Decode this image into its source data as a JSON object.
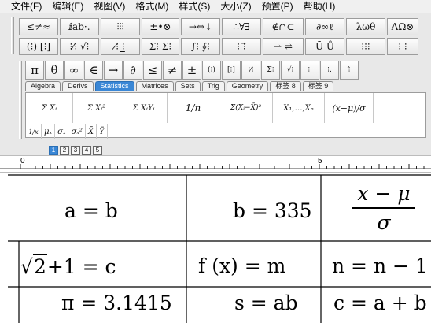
{
  "menu": [
    "文件(F)",
    "编辑(E)",
    "视图(V)",
    "格式(M)",
    "样式(S)",
    "大小(Z)",
    "预置(P)",
    "帮助(H)"
  ],
  "symbol_row1": [
    "≤≠≈",
    "ⅈab·.",
    "⫶⫶⫶",
    "±•⊗",
    "→⇔↓",
    "∴∀∃",
    "∉∩⊂",
    "∂∞ℓ",
    "λωθ",
    "ΛΩ⊗"
  ],
  "symbol_row2": [
    "(⁝) [⁝]",
    "⁝⁄⁝ √⁝",
    "⁝̸ ⁝̲",
    "Σ⁝ Σ⁝",
    "∫⁝ ∮⁝",
    "⁝̄ ⁝⃗",
    "⇀ ⇌",
    "Ū Ů",
    "⁝⁝⁝",
    "⁝ ⁝"
  ],
  "big_row": [
    "π",
    "θ",
    "∞",
    "∈",
    "→",
    "∂",
    "≤",
    "≠",
    "±",
    "(⁝)",
    "[⁝]",
    "⁝⁄⁝",
    "Σ⁝",
    "√⁝",
    "⁝'",
    "⁝.",
    "⁝̂"
  ],
  "tabs": [
    "Algebra",
    "Derivs",
    "Statistics",
    "Matrices",
    "Sets",
    "Trig",
    "Geometry",
    "标签 8",
    "标签 9"
  ],
  "active_tab": "Statistics",
  "templates_row1": [
    "Σ Xᵢ",
    "Σ Xᵢ²",
    "Σ XᵢYᵢ",
    "1/n",
    "Σ(Xᵢ−X̄)²",
    "X₁,…,Xₙ",
    "(x−μ)/σ"
  ],
  "templates_row2": [
    "1/x",
    "μₓ",
    "σₓ",
    "σₓ²",
    "X̄",
    "Ȳ"
  ],
  "tiny_tabs": [
    "1",
    "2",
    "3",
    "4",
    "5"
  ],
  "ruler": {
    "start_label": "0",
    "mid_label": "5"
  },
  "equations": {
    "r1c1": "a = b",
    "r1c2": "b = 335",
    "r1c3_num": "x − μ",
    "r1c3_den": "σ",
    "r2c1_rad": "2",
    "r2c1_rest": "+1 = c",
    "r2c2": "f (x) = m",
    "r2c3": "n = n − 1",
    "r3c1": "π = 3.1415",
    "r3c2": "s = ab",
    "r3c3": "c = a + b"
  }
}
